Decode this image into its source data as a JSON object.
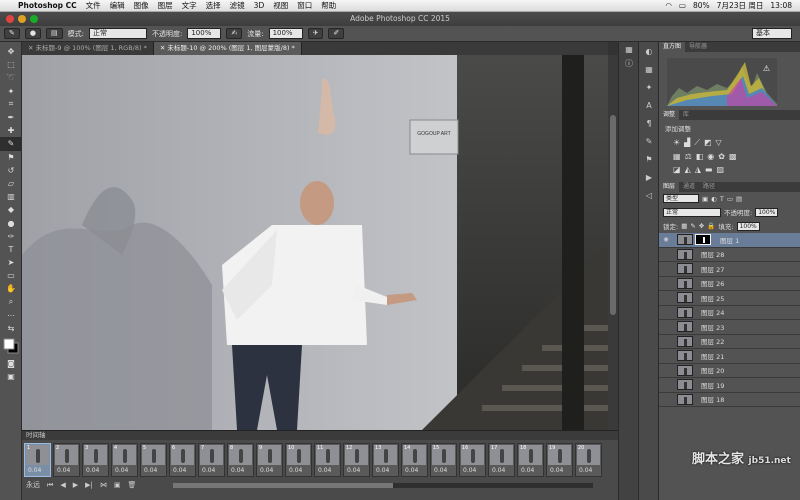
{
  "menubar": {
    "app": "Photoshop CC",
    "items": [
      "文件",
      "编辑",
      "图像",
      "图层",
      "文字",
      "选择",
      "滤镜",
      "3D",
      "视图",
      "窗口",
      "帮助"
    ],
    "status": {
      "battery": "80%",
      "date": "7月23日 周日",
      "time": "13:08"
    }
  },
  "window": {
    "title": "Adobe Photoshop CC 2015"
  },
  "options": {
    "mode_label": "模式:",
    "mode_value": "正常",
    "opacity_label": "不透明度:",
    "opacity_value": "100%",
    "flow_label": "流量:",
    "flow_value": "100%",
    "workspace": "基本"
  },
  "tabs": [
    {
      "label": "未标题-9 @ 100% (图层 1, RGB/8) *"
    },
    {
      "label": "未标题-10 @ 200% (图层 1, 图层蒙版/8) *"
    }
  ],
  "timeline": {
    "title": "时间轴",
    "frames": [
      {
        "n": "1",
        "d": "0.04"
      },
      {
        "n": "2",
        "d": "0.04"
      },
      {
        "n": "3",
        "d": "0.04"
      },
      {
        "n": "4",
        "d": "0.04"
      },
      {
        "n": "5",
        "d": "0.04"
      },
      {
        "n": "6",
        "d": "0.04"
      },
      {
        "n": "7",
        "d": "0.04"
      },
      {
        "n": "8",
        "d": "0.04"
      },
      {
        "n": "9",
        "d": "0.04"
      },
      {
        "n": "10",
        "d": "0.04"
      },
      {
        "n": "11",
        "d": "0.04"
      },
      {
        "n": "12",
        "d": "0.04"
      },
      {
        "n": "13",
        "d": "0.04"
      },
      {
        "n": "14",
        "d": "0.04"
      },
      {
        "n": "15",
        "d": "0.04"
      },
      {
        "n": "16",
        "d": "0.04"
      },
      {
        "n": "17",
        "d": "0.04"
      },
      {
        "n": "18",
        "d": "0.04"
      },
      {
        "n": "19",
        "d": "0.04"
      },
      {
        "n": "20",
        "d": "0.04"
      }
    ],
    "loop": "永远"
  },
  "panels": {
    "histogram_tabs": [
      "直方图",
      "导航器"
    ],
    "adjust_tabs": [
      "调整",
      "库"
    ],
    "adjust_label": "添加调整",
    "layer_tabs": [
      "图层",
      "通道",
      "路径"
    ],
    "kind_label": "类型",
    "blend_mode": "正常",
    "opacity_label": "不透明度:",
    "opacity_value": "100%",
    "lock_label": "锁定:",
    "fill_label": "填充:",
    "fill_value": "100%",
    "layers": [
      "图层 1",
      "图层 28",
      "图层 27",
      "图层 26",
      "图层 25",
      "图层 24",
      "图层 23",
      "图层 22",
      "图层 21",
      "图层 20",
      "图层 19",
      "图层 18"
    ]
  },
  "canvas": {
    "sign_text": "GOGOUP ART"
  },
  "watermark": {
    "main": "脚本之家",
    "domain": "jb51.net"
  },
  "colors": {
    "accent": "#6a7d98",
    "bg": "#535353"
  }
}
